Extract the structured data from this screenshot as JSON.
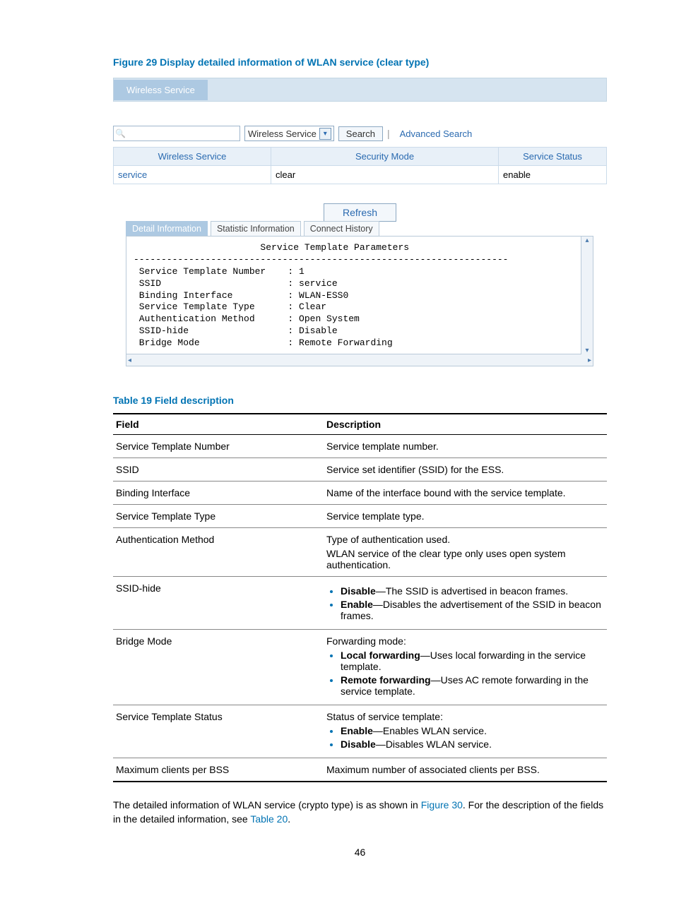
{
  "figure": {
    "caption": "Figure 29 Display detailed information of WLAN service (clear type)",
    "header_tab": "Wireless Service",
    "search": {
      "select_value": "Wireless Service",
      "button": "Search",
      "advanced_link": "Advanced Search"
    },
    "list": {
      "col1": "Wireless Service",
      "col2": "Security Mode",
      "col3": "Service Status",
      "row": {
        "service": "service",
        "mode": "clear",
        "status": "enable"
      }
    },
    "refresh": "Refresh",
    "tabs": {
      "t1": "Detail Information",
      "t2": "Statistic Information",
      "t3": "Connect History"
    },
    "pre": "                       Service Template Parameters\n--------------------------------------------------------------------\n Service Template Number    : 1\n SSID                       : service\n Binding Interface          : WLAN-ESS0\n Service Template Type      : Clear\n Authentication Method      : Open System\n SSID-hide                  : Disable\n Bridge Mode                : Remote Forwarding"
  },
  "table": {
    "caption": "Table 19 Field description",
    "head": {
      "field": "Field",
      "desc": "Description"
    },
    "rows": [
      {
        "field": "Service Template Number",
        "desc": "Service template number."
      },
      {
        "field": "SSID",
        "desc": "Service set identifier (SSID) for the ESS."
      },
      {
        "field": "Binding Interface",
        "desc": "Name of the interface bound with the service template."
      },
      {
        "field": "Service Template Type",
        "desc": "Service template type."
      }
    ],
    "auth": {
      "field": "Authentication Method",
      "line1": "Type of authentication used.",
      "line2": "WLAN service of the clear type only uses open system authentication."
    },
    "ssid": {
      "field": "SSID-hide",
      "b1": "Disable",
      "t1": "—The SSID is advertised in beacon frames.",
      "b2": "Enable",
      "t2": "—Disables the advertisement of the SSID in beacon frames."
    },
    "bridge": {
      "field": "Bridge Mode",
      "lead": "Forwarding mode:",
      "b1": "Local forwarding",
      "t1": "—Uses local forwarding in the service template.",
      "b2": "Remote forwarding",
      "t2": "—Uses AC remote forwarding in the service template."
    },
    "status": {
      "field": "Service Template Status",
      "lead": "Status of service template:",
      "b1": "Enable",
      "t1": "—Enables WLAN service.",
      "b2": "Disable",
      "t2": "—Disables WLAN service."
    },
    "max": {
      "field": "Maximum clients per BSS",
      "desc": "Maximum number of associated clients per BSS."
    }
  },
  "footer": {
    "p1a": "The detailed information of WLAN service (crypto type) is as shown in ",
    "link1": "Figure 30",
    "p1b": ". For the description of the fields in the detailed information, see ",
    "link2": "Table 20",
    "p1c": "."
  },
  "pagenum": "46"
}
